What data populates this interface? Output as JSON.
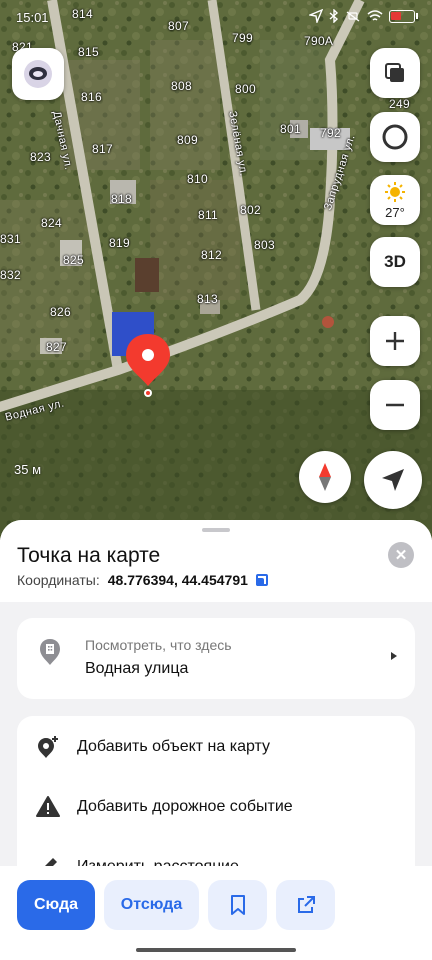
{
  "status": {
    "time": "15:01"
  },
  "map": {
    "scale": "35 м",
    "weather_temp": "27°",
    "mode_3d": "3D",
    "house_numbers": [
      "814",
      "807",
      "799",
      "790А",
      "821",
      "815",
      "816",
      "808",
      "800",
      "249",
      "801",
      "792",
      "817",
      "823",
      "809",
      "818",
      "810",
      "824",
      "802",
      "811",
      "831",
      "819",
      "825",
      "812",
      "803",
      "832",
      "826",
      "813",
      "827"
    ],
    "streets": [
      "Дачная ул.",
      "Зелёная ул.",
      "Запрудная ул.",
      "Водная ул."
    ]
  },
  "sheet": {
    "title": "Точка на карте",
    "coords_label": "Координаты:",
    "coords_value": "48.776394, 44.454791",
    "place_sub": "Посмотреть, что здесь",
    "place_main": "Водная улица",
    "actions": [
      {
        "label": "Добавить объект на карту",
        "icon": "add-place-icon"
      },
      {
        "label": "Добавить дорожное событие",
        "icon": "warning-icon"
      },
      {
        "label": "Измерить расстояние",
        "icon": "ruler-icon"
      }
    ]
  },
  "bottom": {
    "to_here": "Сюда",
    "from_here": "Отсюда",
    "bookmark_icon": "bookmark-icon",
    "share_icon": "share-icon"
  },
  "colors": {
    "accent": "#2a6ae8",
    "pin": "#f33a2e"
  }
}
